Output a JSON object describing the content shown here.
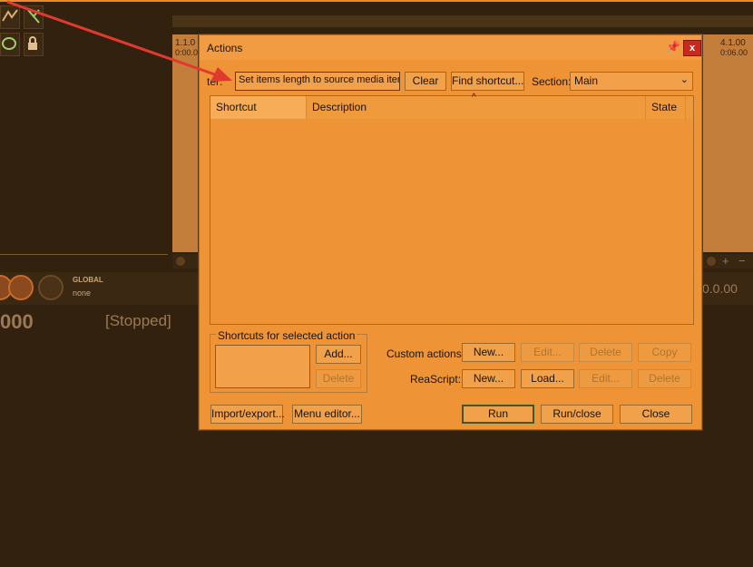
{
  "background": {
    "markers": [
      {
        "bar": "1.1.0",
        "time": "0:00.0"
      },
      {
        "bar": "4.1.00",
        "time": "0:06.00"
      }
    ],
    "global_label": "GLOBAL",
    "automation_mode": "none",
    "time_display": "000",
    "transport_state": "[Stopped]",
    "time_right": "0.0.00",
    "colors": {
      "background": "#33210f",
      "accent": "#e8892a",
      "arrow": "#e03a2e"
    }
  },
  "dialog": {
    "title": "Actions",
    "filter_label": "ter:",
    "filter_value": "Set items length to source media item",
    "clear_label": "Clear",
    "find_shortcut_label": "Find shortcut...",
    "section_label": "Section:",
    "section_value": "Main",
    "columns": [
      "Shortcut",
      "Description",
      "State"
    ],
    "shortcuts_group_title": "Shortcuts for selected action",
    "add_label": "Add...",
    "delete_label": "Delete",
    "custom_actions_label": "Custom actions:",
    "custom_actions_buttons": [
      "New...",
      "Edit...",
      "Delete",
      "Copy"
    ],
    "reascript_label": "ReaScript:",
    "reascript_buttons": [
      "New...",
      "Load...",
      "Edit...",
      "Delete"
    ],
    "import_export_label": "Import/export...",
    "menu_editor_label": "Menu editor...",
    "run_label": "Run",
    "run_close_label": "Run/close",
    "close_label": "Close",
    "colors": {
      "dialog": "#ee9436",
      "close_button": "#c9291f"
    }
  }
}
